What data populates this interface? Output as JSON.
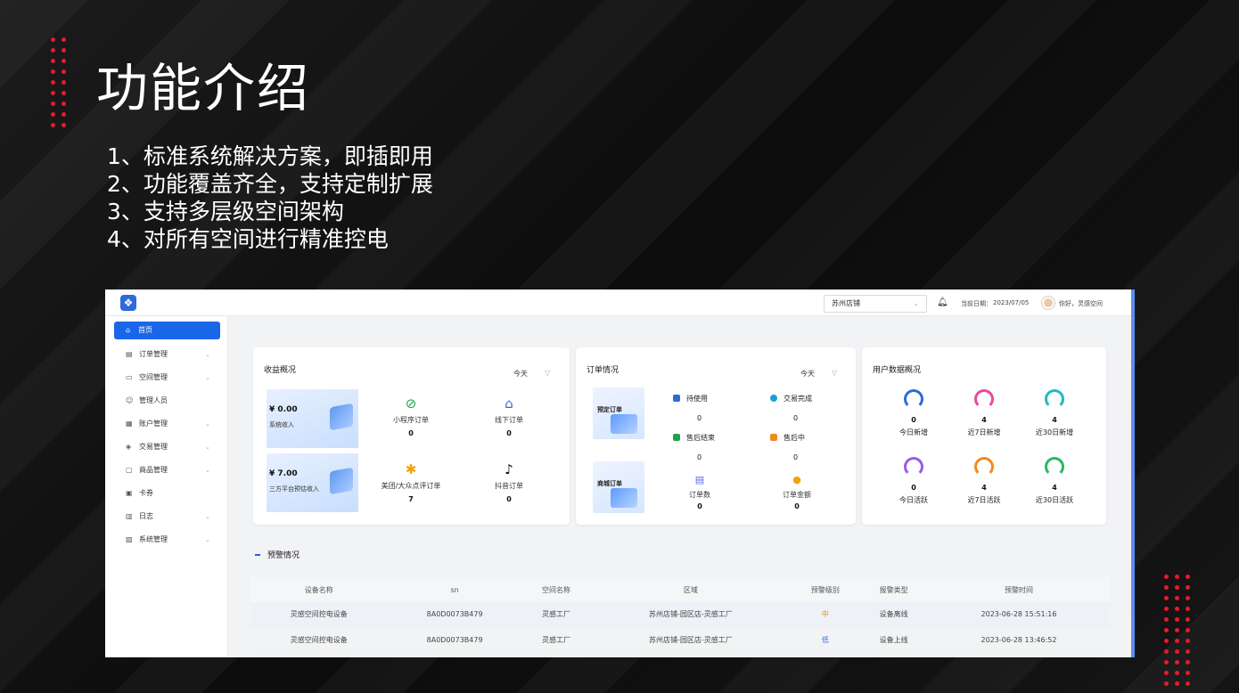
{
  "slide": {
    "title": "功能介绍",
    "features": [
      "1、标准系统解决方案，即插即用",
      "2、功能覆盖齐全，支持定制扩展",
      "3、支持多层级空间架构",
      "4、对所有空间进行精准控电"
    ],
    "accent_color": "#e8192c"
  },
  "app": {
    "header": {
      "store": "苏州店铺",
      "date_label": "当前日期：",
      "date_value": "2023/07/05",
      "greeting": "你好，灵感空间"
    },
    "sidebar": {
      "items": [
        {
          "label": "首页",
          "icon": "home-icon"
        },
        {
          "label": "订单管理",
          "icon": "order-icon"
        },
        {
          "label": "空间管理",
          "icon": "space-icon"
        },
        {
          "label": "管理人员",
          "icon": "people-icon"
        },
        {
          "label": "账户管理",
          "icon": "account-icon"
        },
        {
          "label": "交易管理",
          "icon": "shield-icon"
        },
        {
          "label": "商品管理",
          "icon": "goods-icon"
        },
        {
          "label": "卡券",
          "icon": "card-icon"
        },
        {
          "label": "日志",
          "icon": "log-icon"
        },
        {
          "label": "系统管理",
          "icon": "system-icon"
        }
      ]
    },
    "revenue": {
      "title": "收益概况",
      "filter": "今天",
      "system_income": {
        "amount": "¥ 0.00",
        "label": "系统收入"
      },
      "third_party_income": {
        "amount": "¥ 7.00",
        "label": "三方平台预估收入"
      },
      "metrics": [
        {
          "label": "小程序订单",
          "value": "0",
          "icon": "mini-program-icon",
          "color": "#1ea34a"
        },
        {
          "label": "线下订单",
          "value": "0",
          "icon": "store-icon",
          "color": "#2f6bd8"
        },
        {
          "label": "美团/大众点评订单",
          "value": "7",
          "icon": "meituan-icon",
          "color": "#f5a20a"
        },
        {
          "label": "抖音订单",
          "value": "0",
          "icon": "douyin-icon",
          "color": "#111111"
        }
      ]
    },
    "orders": {
      "title": "订单情况",
      "filter": "今天",
      "booking_label": "预定订单",
      "mall_label": "商城订单",
      "booking_stats": [
        {
          "label": "待使用",
          "value": "0",
          "color": "#2f6bd8"
        },
        {
          "label": "交易完成",
          "value": "0",
          "color": "#1aa0d8"
        },
        {
          "label": "售后结束",
          "value": "0",
          "color": "#1ea34a"
        },
        {
          "label": "售后中",
          "value": "0",
          "color": "#f08a1e"
        }
      ],
      "mall_stats": [
        {
          "label": "订单数",
          "value": "0",
          "color": "#5b6be8"
        },
        {
          "label": "订单金额",
          "value": "0",
          "color": "#f5a20a"
        }
      ]
    },
    "users": {
      "title": "用户数据概况",
      "items": [
        {
          "label": "今日新增",
          "value": "0",
          "color": "#2f6bd8"
        },
        {
          "label": "近7日新增",
          "value": "4",
          "color": "#e84a9a"
        },
        {
          "label": "近30日新增",
          "value": "4",
          "color": "#22b8c8"
        },
        {
          "label": "今日活跃",
          "value": "0",
          "color": "#9a5be8"
        },
        {
          "label": "近7日活跃",
          "value": "4",
          "color": "#f08a1e"
        },
        {
          "label": "近30日活跃",
          "value": "4",
          "color": "#28b864"
        }
      ]
    },
    "alerts": {
      "title": "预警情况",
      "columns": [
        "设备名称",
        "sn",
        "空间名称",
        "区域",
        "预警级别",
        "报警类型",
        "预警时间"
      ],
      "rows": [
        [
          "灵感空间控电设备",
          "8A0D0073B479",
          "灵感工厂",
          "苏州店铺-园区店-灵感工厂",
          "中",
          "设备离线",
          "2023-06-28 15:51:16"
        ],
        [
          "灵感空间控电设备",
          "8A0D0073B479",
          "灵感工厂",
          "苏州店铺-园区店-灵感工厂",
          "低",
          "设备上线",
          "2023-06-28 13:46:52"
        ]
      ]
    }
  }
}
